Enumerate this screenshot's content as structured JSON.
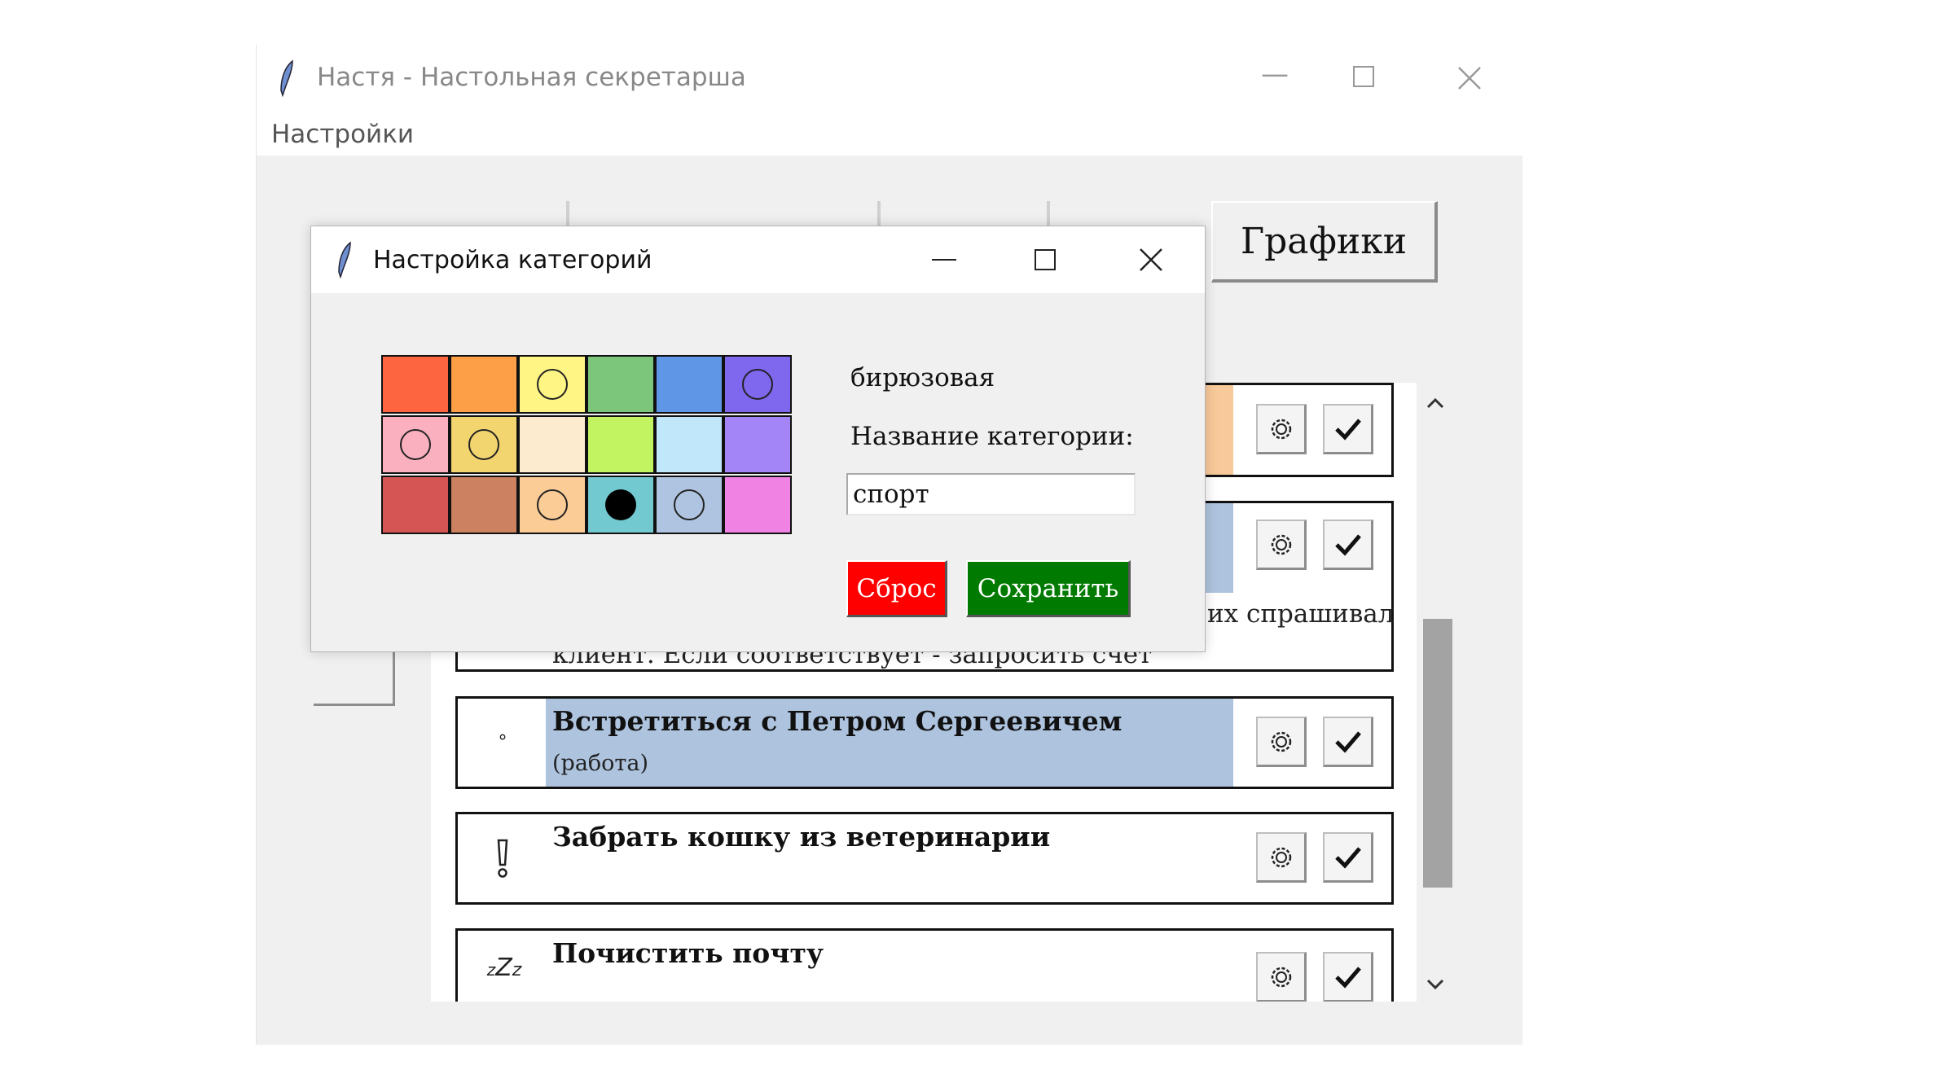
{
  "main_window": {
    "title": "Настя - Настольная секретарша",
    "menu": [
      "Настройки"
    ],
    "tabs": {
      "graphs": "Графики"
    }
  },
  "tasks": [
    {
      "title": "",
      "subtitle": "",
      "icon": "",
      "color": "#f8c99a"
    },
    {
      "title": "",
      "subtitle": "их спрашивал",
      "subtitle2": "клиент. Если соответствует - запросить счёт",
      "icon": "",
      "color": "#aec3de"
    },
    {
      "title": "Встретиться с Петром Сергеевичем",
      "subtitle": "(работа)",
      "icon": "small-circle-icon",
      "color": "#aec3de"
    },
    {
      "title": "Забрать кошку из ветеринарии",
      "subtitle": "",
      "icon": "exclamation-icon",
      "color": "#ffffff"
    },
    {
      "title": "Почистить почту",
      "subtitle": "",
      "icon": "sleep-zzz-icon",
      "color": "#ffffff"
    }
  ],
  "dialog": {
    "title": "Настройка категорий",
    "selected_color_name": "бирюзовая",
    "name_label": "Название категории:",
    "name_value": "спорт",
    "reset_label": "Сброс",
    "save_label": "Сохранить",
    "palette": [
      [
        {
          "color": "#fd6440",
          "mark": "none"
        },
        {
          "color": "#fd9f47",
          "mark": "none"
        },
        {
          "color": "#fff585",
          "mark": "ring"
        },
        {
          "color": "#7cc67c",
          "mark": "none"
        },
        {
          "color": "#6096e6",
          "mark": "none"
        },
        {
          "color": "#7f67ee",
          "mark": "ring"
        }
      ],
      [
        {
          "color": "#fbb0c0",
          "mark": "ring"
        },
        {
          "color": "#f3d56f",
          "mark": "ring"
        },
        {
          "color": "#fdebd0",
          "mark": "none"
        },
        {
          "color": "#c2f462",
          "mark": "none"
        },
        {
          "color": "#c0e7fa",
          "mark": "none"
        },
        {
          "color": "#a385f8",
          "mark": "none"
        }
      ],
      [
        {
          "color": "#d55555",
          "mark": "none"
        },
        {
          "color": "#cc8260",
          "mark": "none"
        },
        {
          "color": "#fccc96",
          "mark": "ring"
        },
        {
          "color": "#72c9cf",
          "mark": "dot"
        },
        {
          "color": "#afc4e0",
          "mark": "ring"
        },
        {
          "color": "#ef82e2",
          "mark": "none"
        }
      ]
    ],
    "reset_color": "#ff0000",
    "save_color": "#007a00"
  }
}
